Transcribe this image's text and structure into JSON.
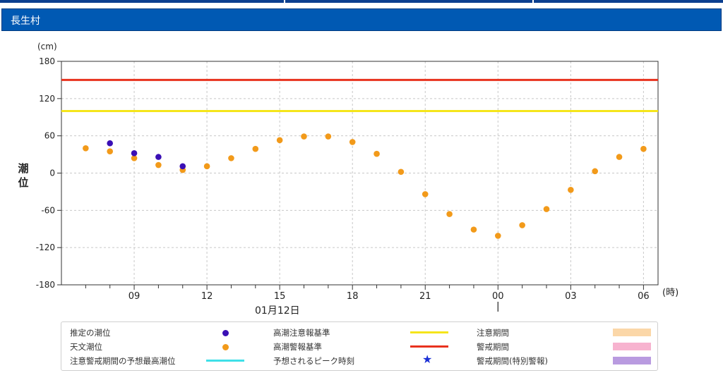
{
  "header": {
    "title": "長生村"
  },
  "chart_data": {
    "type": "scatter",
    "ylabel": "潮位",
    "yunit": "(cm)",
    "xunit": "(時)",
    "date_label": "01月12日",
    "ylim": [
      -180,
      180
    ],
    "yticks": [
      180,
      120,
      60,
      0,
      -60,
      -120,
      -180
    ],
    "xtick_labels": [
      "09",
      "12",
      "15",
      "18",
      "21",
      "00",
      "03",
      "06"
    ],
    "grid": true,
    "thresholds": [
      {
        "name": "高潮警報基準",
        "value": 150,
        "color": "#e8321e"
      },
      {
        "name": "高潮注意報基準",
        "value": 100,
        "color": "#f5e51b"
      }
    ],
    "series": [
      {
        "name": "天文潮位",
        "color": "#f29a1a",
        "x": [
          7,
          8,
          9,
          10,
          11,
          12,
          13,
          14,
          15,
          16,
          17,
          18,
          19,
          20,
          21,
          22,
          23,
          24,
          25,
          26,
          27,
          28,
          29,
          30
        ],
        "values": [
          40,
          35,
          24,
          13,
          5,
          11,
          24,
          39,
          53,
          59,
          59,
          50,
          31,
          2,
          -34,
          -66,
          -91,
          -101,
          -84,
          -58,
          -27,
          3,
          26,
          39
        ]
      },
      {
        "name": "推定の潮位",
        "color": "#3a0fb5",
        "x": [
          8,
          9,
          10,
          11
        ],
        "values": [
          48,
          32,
          26,
          11
        ]
      }
    ]
  },
  "legend": {
    "estimated": "推定の潮位",
    "astronomical": "天文潮位",
    "max_forecast": "注意警戒期間の予想最高潮位",
    "advisory_level": "高潮注意報基準",
    "warning_level": "高潮警報基準",
    "peak_time": "予想されるピーク時刻",
    "advisory_period": "注意期間",
    "warning_period": "警戒期間",
    "special_warning_period": "警戒期間(特別警報)"
  },
  "colors": {
    "estimated": "#3a0fb5",
    "astronomical": "#f29a1a",
    "max_forecast": "#3fe0e8",
    "advisory_level": "#f5e51b",
    "warning_level": "#e8321e",
    "peak_star": "#1a2fd6",
    "advisory_period": "#fbd7a8",
    "warning_period": "#f7b3cf",
    "special_warning_period": "#b99be0"
  }
}
